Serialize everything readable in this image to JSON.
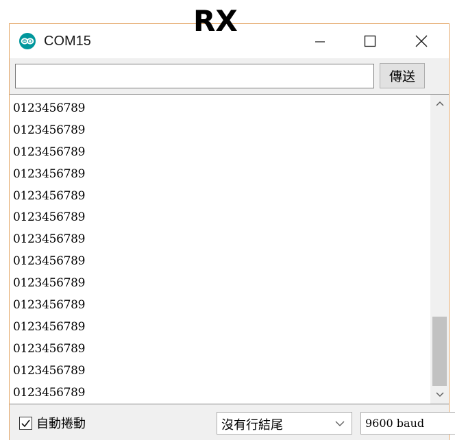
{
  "caption": "RX",
  "window": {
    "title": "COM15",
    "icon": "arduino-icon",
    "controls": {
      "minimize_icon": "minimize-icon",
      "maximize_icon": "maximize-icon",
      "close_icon": "close-icon"
    }
  },
  "send": {
    "input_value": "",
    "button_label": "傳送"
  },
  "output": {
    "lines": [
      "0123456789",
      "0123456789",
      "0123456789",
      "0123456789",
      "0123456789",
      "0123456789",
      "0123456789",
      "0123456789",
      "0123456789",
      "0123456789",
      "0123456789",
      "0123456789",
      "0123456789",
      "0123456789"
    ]
  },
  "footer": {
    "autoscroll_label": "自動捲動",
    "autoscroll_checked": true,
    "line_ending": "沒有行結尾",
    "baud_rate": "9600 baud"
  },
  "colors": {
    "window_border": "#e5a86a",
    "arduino_teal": "#00979c"
  }
}
